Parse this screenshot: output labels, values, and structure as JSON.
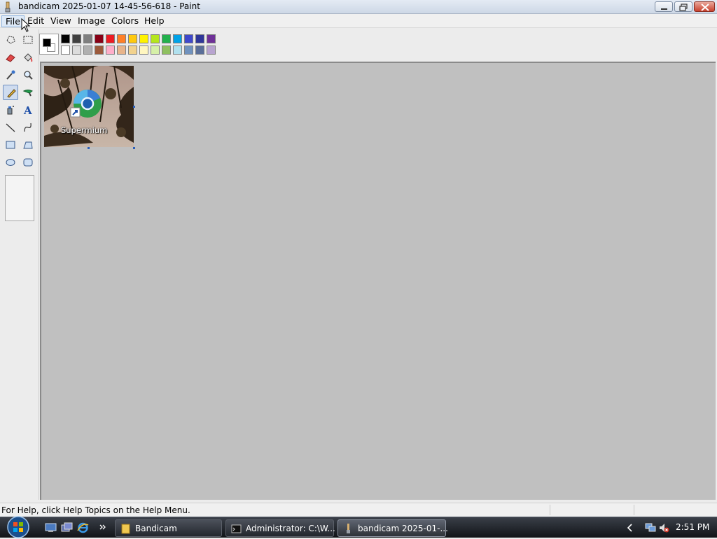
{
  "window": {
    "title": "bandicam 2025-01-07 14-45-56-618 - Paint"
  },
  "menu": {
    "file": "File",
    "edit": "Edit",
    "view": "View",
    "image": "Image",
    "colors": "Colors",
    "help": "Help"
  },
  "tools": [
    {
      "name": "free-form-select-icon"
    },
    {
      "name": "select-icon"
    },
    {
      "name": "eraser-icon"
    },
    {
      "name": "fill-bucket-icon"
    },
    {
      "name": "pick-color-icon"
    },
    {
      "name": "magnifier-icon"
    },
    {
      "name": "pencil-icon",
      "active": true
    },
    {
      "name": "brush-icon"
    },
    {
      "name": "airbrush-icon"
    },
    {
      "name": "text-icon",
      "glyph": "A"
    },
    {
      "name": "line-icon"
    },
    {
      "name": "curve-icon"
    },
    {
      "name": "rectangle-icon"
    },
    {
      "name": "polygon-icon"
    },
    {
      "name": "ellipse-icon"
    },
    {
      "name": "rounded-rectangle-icon"
    }
  ],
  "palette": {
    "foreground": "#000000",
    "background": "#ffffff",
    "top_row": [
      "#000000",
      "#404040",
      "#7f7f7f",
      "#880015",
      "#ed1c24",
      "#ff7f27",
      "#ffc90e",
      "#fff200",
      "#b5e61d",
      "#22b14c",
      "#00a2e8",
      "#3f48cc",
      "#2f3699",
      "#6f3198"
    ],
    "bottom_row": [
      "#ffffff",
      "#dcdcdc",
      "#b0b0b0",
      "#9c5a3c",
      "#ffaec9",
      "#e8b48a",
      "#f2d28e",
      "#fff6c0",
      "#d6f0a8",
      "#8fc060",
      "#b0e0ee",
      "#7092be",
      "#5a6e98",
      "#b8a4d0"
    ]
  },
  "canvas": {
    "desktop_icon_label": "Supermium"
  },
  "status": {
    "help_text": "For Help, click Help Topics on the Help Menu."
  },
  "taskbar": {
    "buttons": [
      {
        "label": "Bandicam"
      },
      {
        "label": "Administrator: C:\\W..."
      },
      {
        "label": "bandicam 2025-01-..."
      }
    ],
    "clock": "2:51 PM"
  }
}
